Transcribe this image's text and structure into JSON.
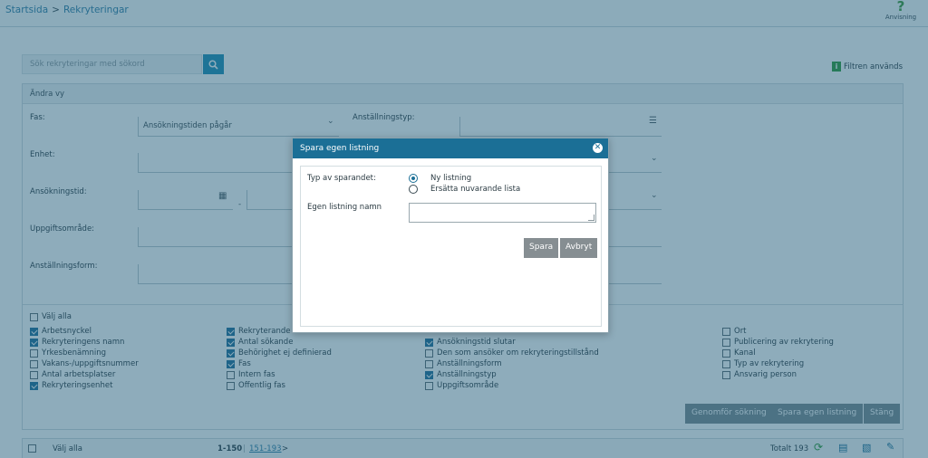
{
  "breadcrumb": {
    "home": "Startsida",
    "separator": ">",
    "current": "Rekryteringar"
  },
  "help": {
    "icon": "question-icon",
    "label": "Anvisning"
  },
  "search": {
    "placeholder": "Sök rekryteringar med sökord",
    "icon": "search-icon"
  },
  "filter_badge": {
    "label": "Filtren används",
    "icon": "filter-active-icon"
  },
  "panel": {
    "title": "Ändra vy",
    "fields": {
      "fas": {
        "label": "Fas:",
        "value": "Ansökningstiden pågår"
      },
      "anstallningstyp": {
        "label": "Anställningstyp:",
        "value": ""
      },
      "enhet": {
        "label": "Enhet:",
        "value": ""
      },
      "ansokningstid": {
        "label": "Ansökningstid:",
        "separator": "-"
      },
      "uppgiftsomrade": {
        "label": "Uppgiftsområde:",
        "value": ""
      },
      "anstallningsform": {
        "label": "Anställningsform:",
        "value": ""
      }
    },
    "select_all": {
      "label": "Välj alla",
      "checked": false
    },
    "columns": [
      [
        {
          "label": "Arbetsnyckel",
          "checked": true
        },
        {
          "label": "Rekryteringens namn",
          "checked": true
        },
        {
          "label": "Yrkesbenämning",
          "checked": false
        },
        {
          "label": "Vakans-/uppgiftsnummer",
          "checked": false
        },
        {
          "label": "Antal arbetsplatser",
          "checked": false
        },
        {
          "label": "Rekryteringsenhet",
          "checked": true
        }
      ],
      [
        {
          "label": "Rekryterande f",
          "checked": true
        },
        {
          "label": "Antal sökande",
          "checked": true
        },
        {
          "label": "Behörighet ej definierad",
          "checked": true
        },
        {
          "label": "Fas",
          "checked": true
        },
        {
          "label": "Intern fas",
          "checked": false
        },
        {
          "label": "Offentlig fas",
          "checked": false
        }
      ],
      [
        {
          "label": "Ansökningstid slutar",
          "checked": true
        },
        {
          "label": "Den som ansöker om rekryteringstillstånd",
          "checked": false
        },
        {
          "label": "Anställningsform",
          "checked": false
        },
        {
          "label": "Anställningstyp",
          "checked": true
        },
        {
          "label": "Uppgiftsområde",
          "checked": false
        }
      ],
      [
        {
          "label": "Ort",
          "checked": false
        },
        {
          "label": "Publicering av rekrytering",
          "checked": false
        },
        {
          "label": "Kanal",
          "checked": false
        },
        {
          "label": "Typ av rekrytering",
          "checked": false
        },
        {
          "label": "Ansvarig person",
          "checked": false
        }
      ]
    ],
    "buttons": {
      "search": "Genomför sökning",
      "save": "Spara egen listning",
      "close": "Stäng"
    }
  },
  "footer": {
    "select_all": "Välj alla",
    "range_current": "1-150",
    "range_sep": "|",
    "range_next": "151-193",
    "next_arrow": ">",
    "total": "Totalt 193"
  },
  "modal": {
    "title": "Spara egen listning",
    "save_type_label": "Typ av sparandet:",
    "options": [
      {
        "label": "Ny listning",
        "selected": true
      },
      {
        "label": "Ersätta nuvarande lista",
        "selected": false
      }
    ],
    "name_label": "Egen listning namn",
    "name_value": "",
    "save_button": "Spara",
    "cancel_button": "Avbryt"
  },
  "colors": {
    "primary": "#1b6f96",
    "link": "#2f7fa6",
    "overlay": "#1e5a78",
    "button": "#7a8a90"
  }
}
